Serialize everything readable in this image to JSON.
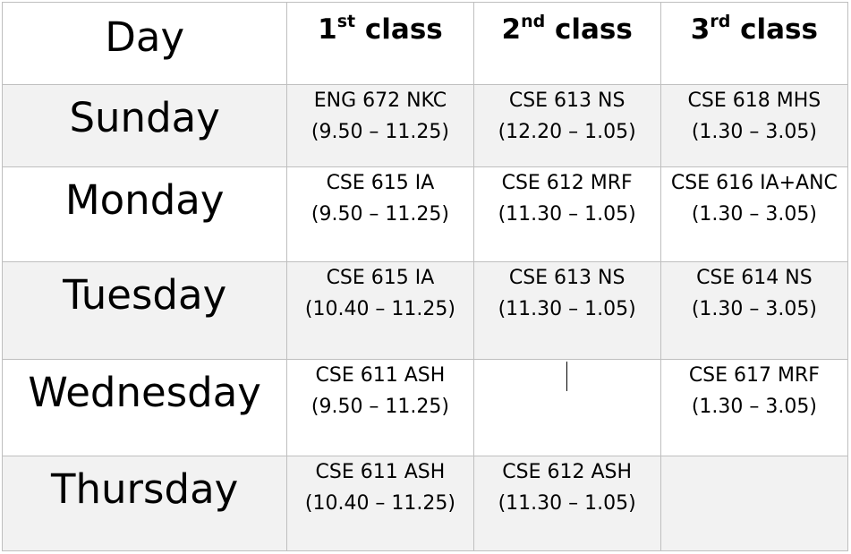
{
  "header": {
    "day_label": "Day",
    "col1": {
      "num": "1",
      "sup": "st",
      "word": " class"
    },
    "col2": {
      "num": "2",
      "sup": "nd",
      "word": " class"
    },
    "col3": {
      "num": "3",
      "sup": "rd",
      "word": " class"
    }
  },
  "rows": [
    {
      "day": "Sunday",
      "c1": {
        "course": "ENG 672 NKC",
        "time": "(9.50 – 11.25)"
      },
      "c2": {
        "course": "CSE 613 NS",
        "time": "(12.20 – 1.05)"
      },
      "c3": {
        "course": "CSE 618 MHS",
        "time": "(1.30 – 3.05)"
      }
    },
    {
      "day": "Monday",
      "c1": {
        "course": "CSE 615 IA",
        "time": "(9.50 – 11.25)"
      },
      "c2": {
        "course": "CSE 612 MRF",
        "time": "(11.30 – 1.05)"
      },
      "c3": {
        "course": "CSE 616 IA+ANC",
        "time": "(1.30 – 3.05)"
      }
    },
    {
      "day": "Tuesday",
      "c1": {
        "course": "CSE 615 IA",
        "time": "(10.40 – 11.25)"
      },
      "c2": {
        "course": "CSE 613 NS",
        "time": "(11.30 – 1.05)"
      },
      "c3": {
        "course": "CSE 614 NS",
        "time": "(1.30 – 3.05)"
      }
    },
    {
      "day": "Wednesday",
      "c1": {
        "course": "CSE 611 ASH",
        "time": "(9.50 – 11.25)"
      },
      "c2": {
        "course": "",
        "time": ""
      },
      "c3": {
        "course": "CSE 617 MRF",
        "time": "(1.30 – 3.05)"
      }
    },
    {
      "day": "Thursday",
      "c1": {
        "course": "CSE 611 ASH",
        "time": "(10.40 – 11.25)"
      },
      "c2": {
        "course": "CSE 612 ASH",
        "time": "(11.30 – 1.05)"
      },
      "c3": {
        "course": "",
        "time": ""
      }
    }
  ]
}
